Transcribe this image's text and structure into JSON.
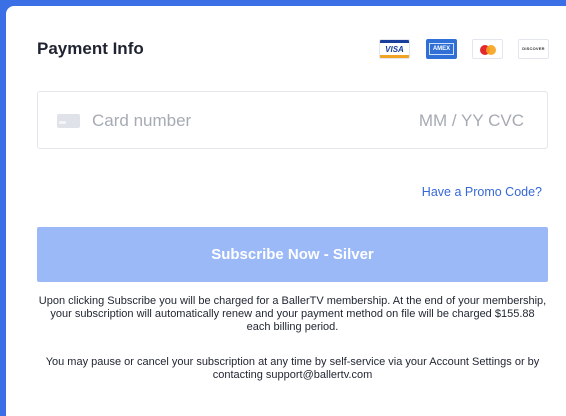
{
  "payment": {
    "title": "Payment Info",
    "brands": {
      "visa": "VISA",
      "amex": "AMEX",
      "discover": "DISCOVER"
    },
    "card_number_placeholder": "Card number",
    "exp_cvc_placeholder": "MM / YY  CVC",
    "promo_link": "Have a Promo Code?",
    "subscribe_button": "Subscribe Now - Silver",
    "notice_1": "Upon clicking Subscribe you will be charged for a BallerTV membership. At the end of your membership, your subscription will automatically renew and your payment method on file will be charged $155.88 each billing period.",
    "notice_2": "You may pause or cancel your subscription at any time by self-service via your Account Settings or by contacting support@ballertv.com"
  },
  "colors": {
    "background": "#3a6fe6",
    "button": "#9bb8f7",
    "link": "#3668d6"
  },
  "icons": {
    "card": "credit-card-icon",
    "visa": "visa-icon",
    "amex": "amex-icon",
    "mastercard": "mastercard-icon",
    "discover": "discover-icon"
  }
}
